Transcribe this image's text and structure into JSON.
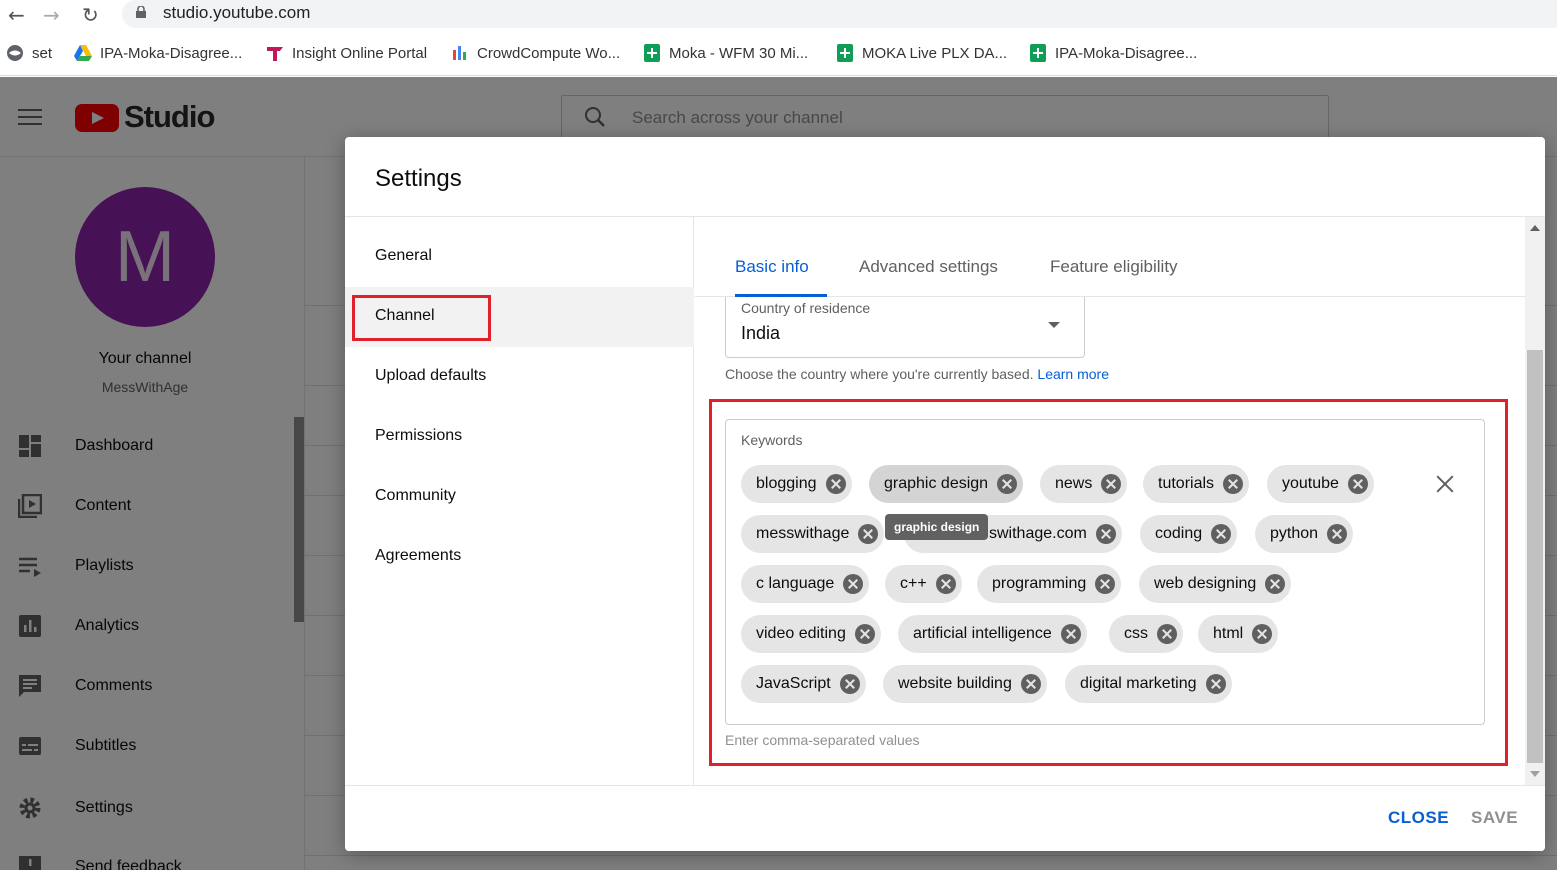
{
  "browser": {
    "url": "studio.youtube.com",
    "bookmarks": [
      {
        "label": "set",
        "icon": "globe-icon"
      },
      {
        "label": "IPA-Moka-Disagree...",
        "icon": "google-drive-icon"
      },
      {
        "label": "Insight Online Portal",
        "icon": "insight-logo-icon"
      },
      {
        "label": "CrowdCompute Wo...",
        "icon": "crowdcompute-icon"
      },
      {
        "label": "Moka - WFM 30 Mi...",
        "icon": "google-sheets-icon"
      },
      {
        "label": "MOKA Live PLX DA...",
        "icon": "google-sheets-icon"
      },
      {
        "label": "IPA-Moka-Disagree...",
        "icon": "google-sheets-icon"
      }
    ]
  },
  "studio": {
    "logo_text": "Studio",
    "search_placeholder": "Search across your channel",
    "avatar_letter": "M",
    "channel_label": "Your channel",
    "channel_handle": "MessWithAge",
    "nav": [
      {
        "label": "Dashboard",
        "icon": "dashboard-icon"
      },
      {
        "label": "Content",
        "icon": "content-icon"
      },
      {
        "label": "Playlists",
        "icon": "playlists-icon"
      },
      {
        "label": "Analytics",
        "icon": "analytics-icon"
      },
      {
        "label": "Comments",
        "icon": "comments-icon"
      },
      {
        "label": "Subtitles",
        "icon": "subtitles-icon"
      },
      {
        "label": "Settings",
        "icon": "gear-icon"
      },
      {
        "label": "Send feedback",
        "icon": "feedback-icon"
      }
    ]
  },
  "dialog": {
    "title": "Settings",
    "sections": [
      "General",
      "Channel",
      "Upload defaults",
      "Permissions",
      "Community",
      "Agreements"
    ],
    "active_section": "Channel",
    "tabs": [
      "Basic info",
      "Advanced settings",
      "Feature eligibility"
    ],
    "active_tab": "Basic info",
    "country": {
      "label": "Country of residence",
      "value": "India",
      "help": "Choose the country where you're currently based.",
      "learn_more": "Learn more"
    },
    "keywords": {
      "label": "Keywords",
      "help": "Enter comma-separated values",
      "tooltip": "graphic design",
      "chips": [
        "blogging",
        "graphic design",
        "news",
        "tutorials",
        "youtube",
        "messwithage",
        "www.messwithage.com",
        "coding",
        "python",
        "c language",
        "c++",
        "programming",
        "web designing",
        "video editing",
        "artificial intelligence",
        "css",
        "html",
        "JavaScript",
        "website building",
        "digital marketing"
      ],
      "chip_visible_text": {
        "www.messwithage.com": "swithage.com"
      }
    },
    "close_label": "CLOSE",
    "save_label": "SAVE"
  },
  "colors": {
    "accent": "#065fd4",
    "highlight_box": "#e0202a",
    "youtube_red": "#ff0000",
    "avatar": "#8e24aa"
  }
}
